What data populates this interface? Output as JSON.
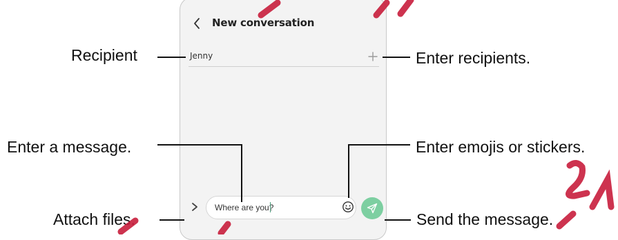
{
  "header": {
    "back_icon": "chevron-left-icon",
    "title": "New conversation"
  },
  "recipient": {
    "value": "Jenny",
    "add_icon": "plus-icon"
  },
  "composer": {
    "attach_icon": "chevron-right-icon",
    "text": "Where are you?",
    "emoji_icon": "smiley-icon",
    "send_icon": "paper-plane-icon"
  },
  "callouts": {
    "recipient": "Recipient",
    "enter_recipients": "Enter recipients.",
    "enter_message": "Enter a message.",
    "enter_emojis": "Enter emojis or stickers.",
    "attach_files": "Attach files.",
    "send_message": "Send the message."
  },
  "colors": {
    "send_button": "#7dcfa1",
    "watermark": "#c81e3c",
    "screen_bg": "#f3f3f3"
  }
}
